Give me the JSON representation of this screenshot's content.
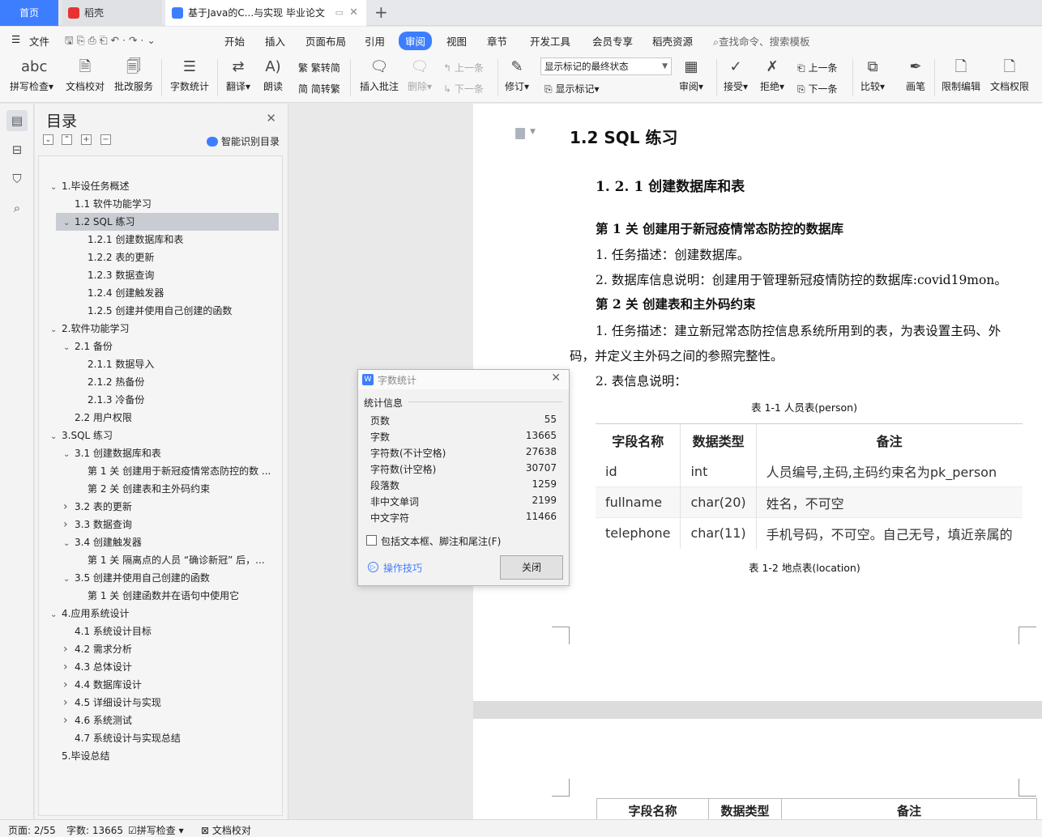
{
  "tabs": {
    "home": "首页",
    "daoke": "稻壳",
    "doc": "基于Java的C...与实现 毕业论文",
    "add": "+"
  },
  "menu": {
    "file": "文件",
    "items": [
      "开始",
      "插入",
      "页面布局",
      "引用",
      "审阅",
      "视图",
      "章节",
      "开发工具",
      "会员专享",
      "稻壳资源"
    ],
    "search": "查找命令、搜索模板"
  },
  "toolbar": {
    "spell": "拼写检查",
    "doccheck": "文档校对",
    "batch": "批改服务",
    "wordcount": "字数统计",
    "translate": "翻译",
    "read": "朗读",
    "t2s": "繁转简",
    "s2t": "简转繁",
    "addcomment": "插入批注",
    "delete": "删除",
    "prev_comment": "上一条",
    "next_comment": "下一条",
    "revise": "修订",
    "markup_state": "显示标记的最终状态",
    "show_markup": "显示标记",
    "review": "审阅",
    "accept": "接受",
    "reject": "拒绝",
    "prev": "上一条",
    "next": "下一条",
    "compare": "比较",
    "pen": "画笔",
    "restrict": "限制编辑",
    "permission": "文档权限",
    "cut": "文"
  },
  "toc": {
    "title": "目录",
    "smart": "智能识别目录",
    "items": [
      {
        "text": "1.毕设任务概述",
        "level": 0,
        "arrow": "expanded"
      },
      {
        "text": "1.1  软件功能学习",
        "level": 1,
        "arrow": ""
      },
      {
        "text": "1.2 SQL 练习",
        "level": 1,
        "arrow": "expanded",
        "selected": true
      },
      {
        "text": "1.2.1  创建数据库和表",
        "level": 2,
        "arrow": ""
      },
      {
        "text": "1.2.2  表的更新",
        "level": 2,
        "arrow": ""
      },
      {
        "text": "1.2.3  数据查询",
        "level": 2,
        "arrow": ""
      },
      {
        "text": "1.2.4  创建触发器",
        "level": 2,
        "arrow": ""
      },
      {
        "text": "1.2.5  创建并使用自己创建的函数",
        "level": 2,
        "arrow": ""
      },
      {
        "text": "2.软件功能学习",
        "level": 0,
        "arrow": "expanded"
      },
      {
        "text": "2.1  备份",
        "level": 1,
        "arrow": "expanded"
      },
      {
        "text": "2.1.1  数据导入",
        "level": 2,
        "arrow": ""
      },
      {
        "text": "2.1.2  热备份",
        "level": 2,
        "arrow": ""
      },
      {
        "text": "2.1.3  冷备份",
        "level": 2,
        "arrow": ""
      },
      {
        "text": "2.2  用户权限",
        "level": 1,
        "arrow": ""
      },
      {
        "text": "3.SQL 练习",
        "level": 0,
        "arrow": "expanded"
      },
      {
        "text": "3.1  创建数据库和表",
        "level": 1,
        "arrow": "expanded"
      },
      {
        "text": "第 1 关  创建用于新冠疫情常态防控的数 ...",
        "level": 2,
        "arrow": ""
      },
      {
        "text": "第 2 关  创建表和主外码约束",
        "level": 2,
        "arrow": ""
      },
      {
        "text": "3.2  表的更新",
        "level": 1,
        "arrow": "collapsed"
      },
      {
        "text": "3.3  数据查询",
        "level": 1,
        "arrow": "collapsed"
      },
      {
        "text": "3.4  创建触发器",
        "level": 1,
        "arrow": "expanded"
      },
      {
        "text": "第 1 关  隔离点的人员 “确诊新冠” 后，...",
        "level": 2,
        "arrow": ""
      },
      {
        "text": "3.5  创建并使用自己创建的函数",
        "level": 1,
        "arrow": "expanded"
      },
      {
        "text": "第 1 关  创建函数并在语句中使用它",
        "level": 2,
        "arrow": ""
      },
      {
        "text": "4.应用系统设计",
        "level": 0,
        "arrow": "expanded"
      },
      {
        "text": "4.1 系统设计目标",
        "level": 1,
        "arrow": ""
      },
      {
        "text": "4.2  需求分析",
        "level": 1,
        "arrow": "collapsed"
      },
      {
        "text": "4.3  总体设计",
        "level": 1,
        "arrow": "collapsed"
      },
      {
        "text": "4.4  数据库设计",
        "level": 1,
        "arrow": "collapsed"
      },
      {
        "text": "4.5  详细设计与实现",
        "level": 1,
        "arrow": "collapsed"
      },
      {
        "text": "4.6  系统测试",
        "level": 1,
        "arrow": "collapsed"
      },
      {
        "text": "4.7  系统设计与实现总结",
        "level": 1,
        "arrow": ""
      },
      {
        "text": "5.毕设总结",
        "level": 0,
        "arrow": ""
      }
    ]
  },
  "doc": {
    "h12": "1.2 SQL 练习",
    "h121": "1. 2. 1  创建数据库和表",
    "l1": "第 1 关  创建用于新冠疫情常态防控的数据库",
    "l2": "1.  任务描述：创建数据库。",
    "l3": "2.  数据库信息说明：创建用于管理新冠疫情防控的数据库:covid19mon。",
    "l4": "第 2 关  创建表和主外码约束",
    "l5": "1.  任务描述：建立新冠常态防控信息系统所用到的表，为表设置主码、外",
    "l6": "码，并定义主外码之间的参照完整性。",
    "l7": "2.  表信息说明：",
    "cap1": "表  1-1  人员表(person)",
    "cap2": "表  1-2  地点表(location)",
    "table": {
      "headers": [
        "字段名称",
        "数据类型",
        "备注"
      ],
      "rows": [
        [
          "id",
          "int",
          "人员编号,主码,主码约束名为pk_person"
        ],
        [
          "fullname",
          "char(20)",
          "姓名，不可空"
        ],
        [
          "telephone",
          "char(11)",
          "手机号码，不可空。自己无号，填近亲属的"
        ]
      ]
    },
    "table2_headers": [
      "字段名称",
      "数据类型",
      "备注"
    ]
  },
  "dialog": {
    "title": "字数统计",
    "section": "统计信息",
    "rows": [
      {
        "label": "页数",
        "value": "55"
      },
      {
        "label": "字数",
        "value": "13665"
      },
      {
        "label": "字符数(不计空格)",
        "value": "27638"
      },
      {
        "label": "字符数(计空格)",
        "value": "30707"
      },
      {
        "label": "段落数",
        "value": "1259"
      },
      {
        "label": "非中文单词",
        "value": "2199"
      },
      {
        "label": "中文字符",
        "value": "11466"
      }
    ],
    "checkbox": "包括文本框、脚注和尾注(F)",
    "tip": "操作技巧",
    "close": "关闭"
  },
  "status": {
    "page": "页面: 2/55",
    "words": "字数: 13665",
    "spell": "拼写检查",
    "check": "文档校对"
  },
  "colors": {
    "accent": "#3d7eff",
    "selection": "#c9cdd3"
  }
}
